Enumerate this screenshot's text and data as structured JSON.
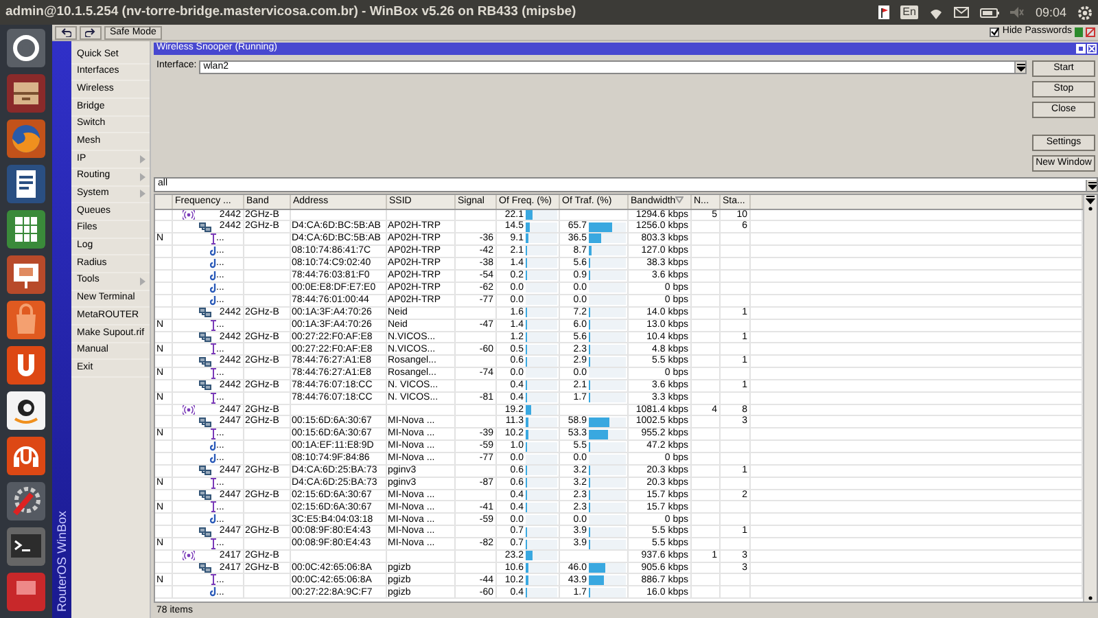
{
  "top_bar": {
    "title": "admin@10.1.5.254 (nv-torre-bridge.mastervicosa.com.br) - WinBox v5.26 on RB433 (mipsbe)",
    "keyboard": "En",
    "clock": "09:04"
  },
  "toolbar": {
    "safe_mode": "Safe Mode",
    "hide_passwords": {
      "label": "Hide Passwords",
      "checked": true
    }
  },
  "side_strip": {
    "label": "RouterOS WinBox"
  },
  "menu": [
    {
      "label": "Quick Set",
      "has_submenu": false
    },
    {
      "label": "Interfaces",
      "has_submenu": false
    },
    {
      "label": "Wireless",
      "has_submenu": false
    },
    {
      "label": "Bridge",
      "has_submenu": false
    },
    {
      "label": "Switch",
      "has_submenu": false
    },
    {
      "label": "Mesh",
      "has_submenu": false
    },
    {
      "label": "IP",
      "has_submenu": true
    },
    {
      "label": "Routing",
      "has_submenu": true
    },
    {
      "label": "System",
      "has_submenu": true
    },
    {
      "label": "Queues",
      "has_submenu": false
    },
    {
      "label": "Files",
      "has_submenu": false
    },
    {
      "label": "Log",
      "has_submenu": false
    },
    {
      "label": "Radius",
      "has_submenu": false
    },
    {
      "label": "Tools",
      "has_submenu": true
    },
    {
      "label": "New Terminal",
      "has_submenu": false
    },
    {
      "label": "MetaROUTER",
      "has_submenu": false
    },
    {
      "label": "Make Supout.rif",
      "has_submenu": false
    },
    {
      "label": "Manual",
      "has_submenu": false
    },
    {
      "label": "Exit",
      "has_submenu": false
    }
  ],
  "window": {
    "title": "Wireless Snooper (Running)",
    "interface_label": "Interface:",
    "interface_value": "wlan2",
    "buttons": [
      "Start",
      "Stop",
      "Close",
      "Settings",
      "New Window"
    ],
    "filter": "all"
  },
  "table": {
    "columns": [
      "Frequency ...",
      "Band",
      "Address",
      "SSID",
      "Signal",
      "Of Freq. (%)",
      "Of Traf. (%)",
      "Bandwidth",
      "N...",
      "Sta..."
    ],
    "rows": [
      {
        "kind": "frequency",
        "frequency": "2442",
        "band": "2GHz-B",
        "of_freq": {
          "text": "22.1",
          "level": 0.221
        },
        "bandwidth": "1294.6 kbps",
        "n": "5",
        "sta": "10",
        "children": [
          {
            "kind": "ap",
            "frequency": "2442",
            "band": "2GHz-B",
            "address": "D4:CA:6D:BC:5B:AB",
            "ssid": "AP02H-TRP",
            "of_freq": {
              "text": "14.5",
              "level": 0.145
            },
            "of_traf": {
              "text": "65.7",
              "level": 0.657
            },
            "bandwidth": "1256.0 kbps",
            "sta": "6",
            "children": [
              {
                "kind": "client",
                "flag": "N",
                "frequency": "...",
                "address": "D4:CA:6D:BC:5B:AB",
                "ssid": "AP02H-TRP",
                "signal": "-36",
                "of_freq": {
                  "text": "9.1",
                  "level": 0.091
                },
                "of_traf": {
                  "text": "36.5",
                  "level": 0.365
                },
                "bandwidth": "803.3 kbps"
              },
              {
                "kind": "client",
                "frequency": "...",
                "address": "08:10:74:86:41:7C",
                "ssid": "AP02H-TRP",
                "signal": "-42",
                "of_freq": {
                  "text": "2.1",
                  "level": 0.021
                },
                "of_traf": {
                  "text": "8.7",
                  "level": 0.087
                },
                "bandwidth": "127.0 kbps"
              },
              {
                "kind": "client",
                "frequency": "...",
                "address": "08:10:74:C9:02:40",
                "ssid": "AP02H-TRP",
                "signal": "-38",
                "of_freq": {
                  "text": "1.4",
                  "level": 0.014
                },
                "of_traf": {
                  "text": "5.6",
                  "level": 0.056
                },
                "bandwidth": "38.3 kbps"
              },
              {
                "kind": "client",
                "frequency": "...",
                "address": "78:44:76:03:81:F0",
                "ssid": "AP02H-TRP",
                "signal": "-54",
                "of_freq": {
                  "text": "0.2",
                  "level": 0.002
                },
                "of_traf": {
                  "text": "0.9",
                  "level": 0.009
                },
                "bandwidth": "3.6 kbps"
              },
              {
                "kind": "client",
                "frequency": "...",
                "address": "00:0E:E8:DF:E7:E0",
                "ssid": "AP02H-TRP",
                "signal": "-62",
                "of_freq": {
                  "text": "0.0"
                },
                "of_traf": {
                  "text": "0.0"
                },
                "bandwidth": "0 bps"
              },
              {
                "kind": "client",
                "frequency": "...",
                "address": "78:44:76:01:00:44",
                "ssid": "AP02H-TRP",
                "signal": "-77",
                "of_freq": {
                  "text": "0.0"
                },
                "of_traf": {
                  "text": "0.0"
                },
                "bandwidth": "0 bps"
              }
            ]
          },
          {
            "kind": "ap",
            "frequency": "2442",
            "band": "2GHz-B",
            "address": "00:1A:3F:A4:70:26",
            "ssid": "Neid",
            "of_freq": {
              "text": "1.6",
              "level": 0.016
            },
            "of_traf": {
              "text": "7.2",
              "level": 0.072
            },
            "bandwidth": "14.0 kbps",
            "sta": "1",
            "children": [
              {
                "kind": "client",
                "flag": "N",
                "frequency": "...",
                "address": "00:1A:3F:A4:70:26",
                "ssid": "Neid",
                "signal": "-47",
                "of_freq": {
                  "text": "1.4",
                  "level": 0.014
                },
                "of_traf": {
                  "text": "6.0",
                  "level": 0.06
                },
                "bandwidth": "13.0 kbps"
              }
            ]
          },
          {
            "kind": "ap",
            "frequency": "2442",
            "band": "2GHz-B",
            "address": "00:27:22:F0:AF:E8",
            "ssid": "N.VICOS...",
            "of_freq": {
              "text": "1.2",
              "level": 0.012
            },
            "of_traf": {
              "text": "5.6",
              "level": 0.056
            },
            "bandwidth": "10.4 kbps",
            "sta": "1",
            "children": [
              {
                "kind": "client",
                "flag": "N",
                "frequency": "...",
                "address": "00:27:22:F0:AF:E8",
                "ssid": "N.VICOS...",
                "signal": "-60",
                "of_freq": {
                  "text": "0.5",
                  "level": 0.005
                },
                "of_traf": {
                  "text": "2.3",
                  "level": 0.023
                },
                "bandwidth": "4.8 kbps"
              }
            ]
          },
          {
            "kind": "ap",
            "frequency": "2442",
            "band": "2GHz-B",
            "address": "78:44:76:27:A1:E8",
            "ssid": "Rosangel...",
            "of_freq": {
              "text": "0.6",
              "level": 0.006
            },
            "of_traf": {
              "text": "2.9",
              "level": 0.029
            },
            "bandwidth": "5.5 kbps",
            "sta": "1",
            "children": [
              {
                "kind": "client",
                "flag": "N",
                "frequency": "...",
                "address": "78:44:76:27:A1:E8",
                "ssid": "Rosangel...",
                "signal": "-74",
                "of_freq": {
                  "text": "0.0"
                },
                "of_traf": {
                  "text": "0.0"
                },
                "bandwidth": "0 bps"
              }
            ]
          },
          {
            "kind": "ap",
            "frequency": "2442",
            "band": "2GHz-B",
            "address": "78:44:76:07:18:CC",
            "ssid": "N. VICOS...",
            "of_freq": {
              "text": "0.4",
              "level": 0.004
            },
            "of_traf": {
              "text": "2.1",
              "level": 0.021
            },
            "bandwidth": "3.6 kbps",
            "sta": "1",
            "children": [
              {
                "kind": "client",
                "flag": "N",
                "frequency": "...",
                "address": "78:44:76:07:18:CC",
                "ssid": "N. VICOS...",
                "signal": "-81",
                "of_freq": {
                  "text": "0.4",
                  "level": 0.004
                },
                "of_traf": {
                  "text": "1.7",
                  "level": 0.017
                },
                "bandwidth": "3.3 kbps"
              }
            ]
          }
        ]
      },
      {
        "kind": "frequency",
        "frequency": "2447",
        "band": "2GHz-B",
        "of_freq": {
          "text": "19.2",
          "level": 0.192
        },
        "bandwidth": "1081.4 kbps",
        "n": "4",
        "sta": "8",
        "children": [
          {
            "kind": "ap",
            "frequency": "2447",
            "band": "2GHz-B",
            "address": "00:15:6D:6A:30:67",
            "ssid": "MI-Nova ...",
            "of_freq": {
              "text": "11.3",
              "level": 0.113
            },
            "of_traf": {
              "text": "58.9",
              "level": 0.589
            },
            "bandwidth": "1002.5 kbps",
            "sta": "3",
            "children": [
              {
                "kind": "client",
                "flag": "N",
                "frequency": "...",
                "address": "00:15:6D:6A:30:67",
                "ssid": "MI-Nova ...",
                "signal": "-39",
                "of_freq": {
                  "text": "10.2",
                  "level": 0.102
                },
                "of_traf": {
                  "text": "53.3",
                  "level": 0.533
                },
                "bandwidth": "955.2 kbps"
              },
              {
                "kind": "client",
                "frequency": "...",
                "address": "00:1A:EF:11:E8:9D",
                "ssid": "MI-Nova ...",
                "signal": "-59",
                "of_freq": {
                  "text": "1.0",
                  "level": 0.01
                },
                "of_traf": {
                  "text": "5.5",
                  "level": 0.055
                },
                "bandwidth": "47.2 kbps"
              },
              {
                "kind": "client",
                "frequency": "...",
                "address": "08:10:74:9F:84:86",
                "ssid": "MI-Nova ...",
                "signal": "-77",
                "of_freq": {
                  "text": "0.0"
                },
                "of_traf": {
                  "text": "0.0"
                },
                "bandwidth": "0 bps"
              }
            ]
          },
          {
            "kind": "ap",
            "frequency": "2447",
            "band": "2GHz-B",
            "address": "D4:CA:6D:25:BA:73",
            "ssid": "pginv3",
            "of_freq": {
              "text": "0.6",
              "level": 0.006
            },
            "of_traf": {
              "text": "3.2",
              "level": 0.032
            },
            "bandwidth": "20.3 kbps",
            "sta": "1",
            "children": [
              {
                "kind": "client",
                "flag": "N",
                "frequency": "...",
                "address": "D4:CA:6D:25:BA:73",
                "ssid": "pginv3",
                "signal": "-87",
                "of_freq": {
                  "text": "0.6",
                  "level": 0.006
                },
                "of_traf": {
                  "text": "3.2",
                  "level": 0.032
                },
                "bandwidth": "20.3 kbps"
              }
            ]
          },
          {
            "kind": "ap",
            "frequency": "2447",
            "band": "2GHz-B",
            "address": "02:15:6D:6A:30:67",
            "ssid": "MI-Nova ...",
            "of_freq": {
              "text": "0.4",
              "level": 0.004
            },
            "of_traf": {
              "text": "2.3",
              "level": 0.023
            },
            "bandwidth": "15.7 kbps",
            "sta": "2",
            "children": [
              {
                "kind": "client",
                "flag": "N",
                "frequency": "...",
                "address": "02:15:6D:6A:30:67",
                "ssid": "MI-Nova ...",
                "signal": "-41",
                "of_freq": {
                  "text": "0.4",
                  "level": 0.004
                },
                "of_traf": {
                  "text": "2.3",
                  "level": 0.023
                },
                "bandwidth": "15.7 kbps"
              },
              {
                "kind": "client",
                "frequency": "...",
                "address": "3C:E5:B4:04:03:18",
                "ssid": "MI-Nova ...",
                "signal": "-59",
                "of_freq": {
                  "text": "0.0"
                },
                "of_traf": {
                  "text": "0.0"
                },
                "bandwidth": "0 bps"
              }
            ]
          },
          {
            "kind": "ap",
            "frequency": "2447",
            "band": "2GHz-B",
            "address": "00:08:9F:80:E4:43",
            "ssid": "MI-Nova ...",
            "of_freq": {
              "text": "0.7",
              "level": 0.007
            },
            "of_traf": {
              "text": "3.9",
              "level": 0.039
            },
            "bandwidth": "5.5 kbps",
            "sta": "1",
            "children": [
              {
                "kind": "client",
                "flag": "N",
                "frequency": "...",
                "address": "00:08:9F:80:E4:43",
                "ssid": "MI-Nova ...",
                "signal": "-82",
                "of_freq": {
                  "text": "0.7",
                  "level": 0.007
                },
                "of_traf": {
                  "text": "3.9",
                  "level": 0.039
                },
                "bandwidth": "5.5 kbps"
              }
            ]
          }
        ]
      },
      {
        "kind": "frequency",
        "frequency": "2417",
        "band": "2GHz-B",
        "of_freq": {
          "text": "23.2",
          "level": 0.232
        },
        "bandwidth": "937.6 kbps",
        "n": "1",
        "sta": "3",
        "children": [
          {
            "kind": "ap",
            "frequency": "2417",
            "band": "2GHz-B",
            "address": "00:0C:42:65:06:8A",
            "ssid": "pgizb",
            "of_freq": {
              "text": "10.6",
              "level": 0.106
            },
            "of_traf": {
              "text": "46.0",
              "level": 0.46
            },
            "bandwidth": "905.6 kbps",
            "sta": "3",
            "children": [
              {
                "kind": "client",
                "flag": "N",
                "frequency": "...",
                "address": "00:0C:42:65:06:8A",
                "ssid": "pgizb",
                "signal": "-44",
                "of_freq": {
                  "text": "10.2",
                  "level": 0.102
                },
                "of_traf": {
                  "text": "43.9",
                  "level": 0.439
                },
                "bandwidth": "886.7 kbps"
              },
              {
                "kind": "client",
                "frequency": "...",
                "address": "00:27:22:8A:9C:F7",
                "ssid": "pgizb",
                "signal": "-60",
                "of_freq": {
                  "text": "0.4",
                  "level": 0.004
                },
                "of_traf": {
                  "text": "1.7",
                  "level": 0.017
                },
                "bandwidth": "16.0 kbps"
              }
            ]
          }
        ]
      }
    ]
  },
  "status_bar": "78 items"
}
